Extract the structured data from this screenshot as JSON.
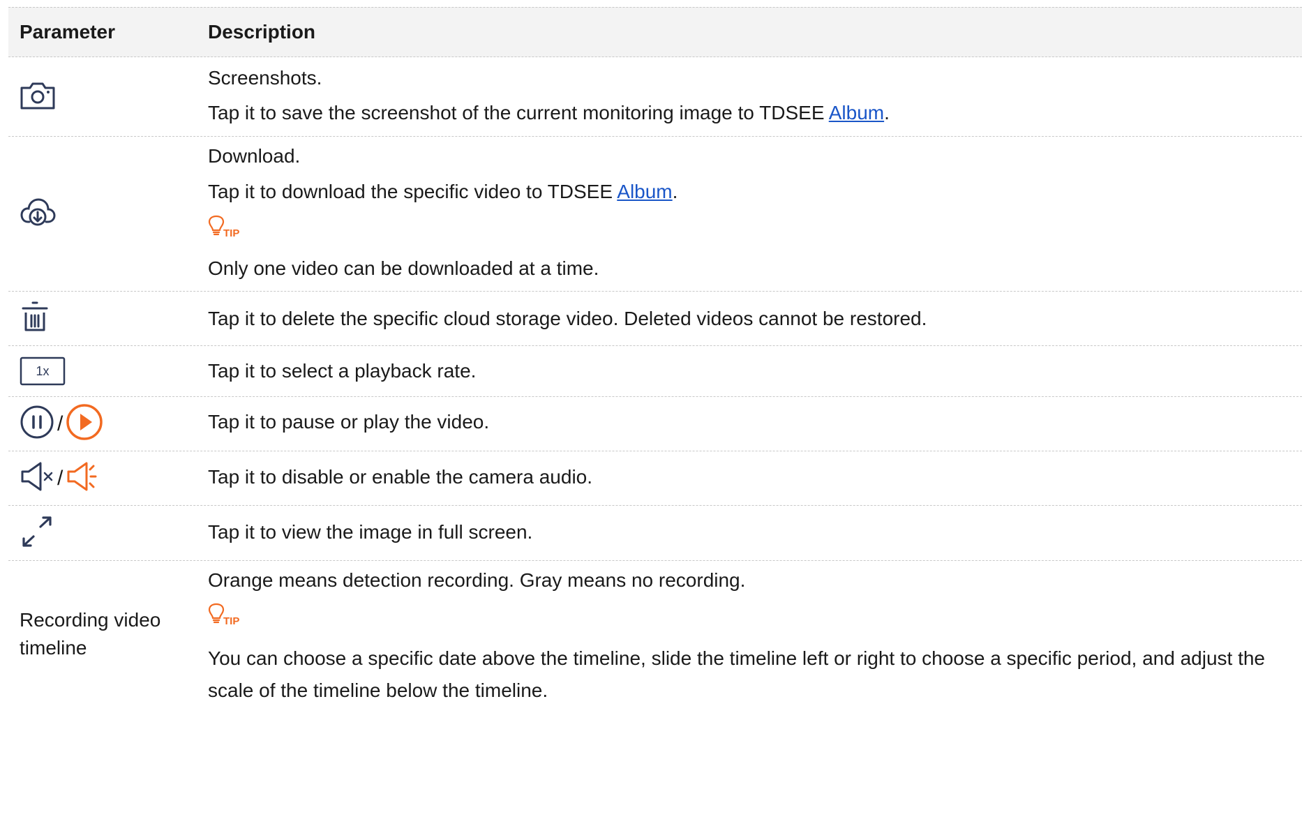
{
  "header": {
    "col_parameter": "Parameter",
    "col_description": "Description"
  },
  "rows": {
    "screenshot": {
      "icon": "camera-icon",
      "title": "Screenshots.",
      "desc_prefix": "Tap it to save the screenshot of the current monitoring image to TDSEE ",
      "link": "Album",
      "desc_suffix": "."
    },
    "download": {
      "icon": "cloud-download-icon",
      "title": "Download.",
      "desc_prefix": "Tap it to download the specific video to TDSEE ",
      "link": "Album",
      "desc_suffix": ".",
      "tip_label": "TIP",
      "tip_text": "Only one video can be downloaded at a time."
    },
    "delete": {
      "icon": "trash-icon",
      "text": "Tap it to delete the specific cloud storage video. Deleted videos cannot be restored."
    },
    "rate": {
      "icon_label": "1x",
      "text": "Tap it to select a playback rate."
    },
    "pause_play": {
      "icons": [
        "pause-icon",
        "play-icon"
      ],
      "separator": "/",
      "text": "Tap it to pause or play the video."
    },
    "audio": {
      "icons": [
        "speaker-muted-icon",
        "speaker-on-icon"
      ],
      "separator": "/",
      "text": "Tap it to disable or enable the camera audio."
    },
    "fullscreen": {
      "icon": "fullscreen-icon",
      "text": "Tap it to view the image in full screen."
    },
    "timeline": {
      "param": "Recording video timeline",
      "text": "Orange means detection recording. Gray means no recording.",
      "tip_label": "TIP",
      "tip_text": "You can choose a specific date above the timeline, slide the timeline left or right to choose a specific period, and adjust the scale of the timeline below the timeline."
    }
  },
  "colors": {
    "accent_orange": "#f26a21",
    "icon_dark": "#2e3a59",
    "link_blue": "#1a56c8",
    "header_bg": "#f3f3f3"
  }
}
